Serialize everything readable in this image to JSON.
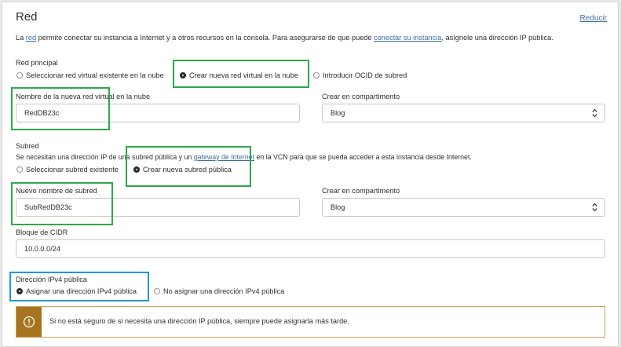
{
  "section": {
    "title": "Red",
    "collapse_label": "Reducir"
  },
  "intro": {
    "part1": "La ",
    "link1": "red",
    "part2": " permite conectar su instancia a Internet y a otros recursos en la consola. Para asegurarse de que puede ",
    "link2": "conectar su instancia",
    "part3": ", asígnele una dirección IP pública."
  },
  "primary_network": {
    "label": "Red principal",
    "options": [
      "Seleccionar red virtual existente en la nube",
      "Crear nueva red virtual en la nube",
      "Introducir OCID de subred"
    ],
    "selected": "Crear nueva red virtual en la nube"
  },
  "vcn_name": {
    "label": "Nombre de la nueva red virtual en la nube",
    "value": "RedDB23c"
  },
  "vcn_compartment": {
    "label": "Crear en compartimento",
    "value": "Blog"
  },
  "subnet": {
    "label": "Subred",
    "help_part1": "Se necesitan una dirección IP de una subred pública y un ",
    "help_link": "gateway de Internet",
    "help_part2": " en la VCN para que se pueda acceder a esta instancia desde Internet.",
    "options": [
      "Seleccionar subred existente",
      "Crear nueva subred pública"
    ],
    "selected": "Crear nueva subred pública"
  },
  "subnet_name": {
    "label": "Nuevo nombre de subred",
    "value": "SubRedDB23c"
  },
  "subnet_compartment": {
    "label": "Crear en compartimento",
    "value": "Blog"
  },
  "cidr": {
    "label": "Bloque de CIDR",
    "value": "10.0.0.0/24"
  },
  "public_ipv4": {
    "label": "Dirección IPv4 pública",
    "options": [
      "Asignar una dirección IPv4 pública",
      "No asignar una dirección IPv4 pública"
    ],
    "selected": "Asignar una dirección IPv4 pública"
  },
  "alert": {
    "icon": "warning-circle-icon",
    "message": "Si no está seguro de si necesita una dirección IP pública, siempre puede asignarla más tarde."
  },
  "colors": {
    "link": "#3a6fa0",
    "highlight_green": "#2ea84a",
    "highlight_blue": "#1e9ad6",
    "warning_bar": "#a6741e",
    "warning_border": "#c9a15a"
  }
}
